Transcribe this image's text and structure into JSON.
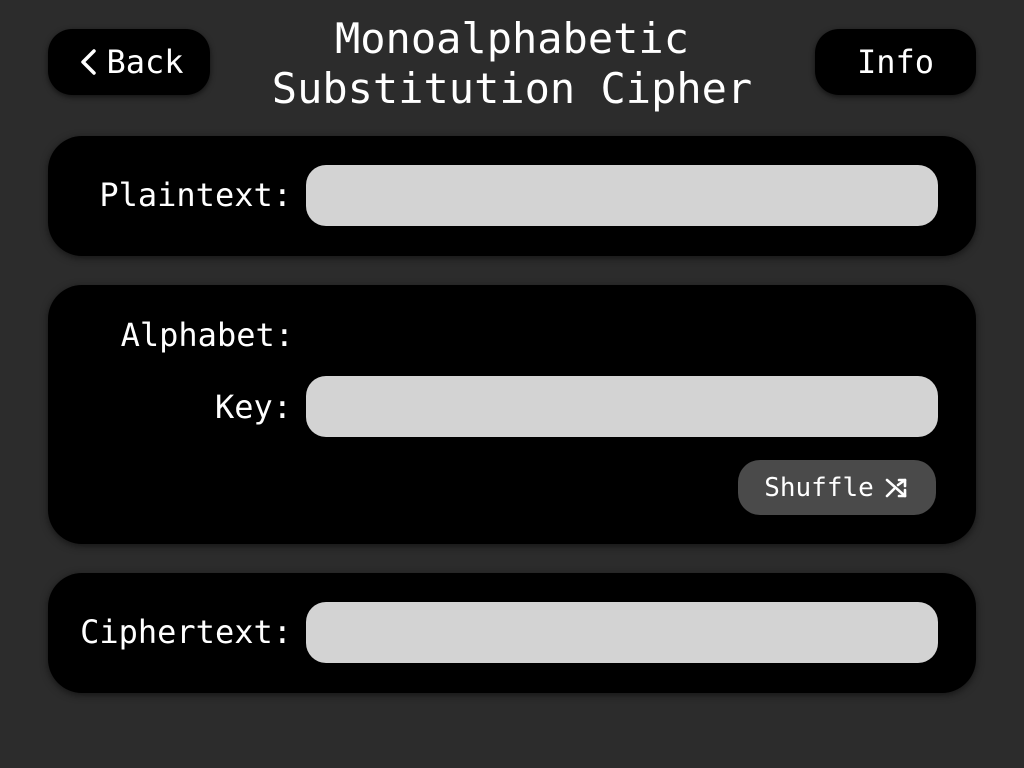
{
  "header": {
    "back_label": "Back",
    "title_line1": "Monoalphabetic",
    "title_line2": "Substitution Cipher",
    "info_label": "Info"
  },
  "plaintext": {
    "label": "Plaintext:",
    "value": "",
    "placeholder": ""
  },
  "key_section": {
    "alphabet_label": "Alphabet:",
    "key_label": "Key:",
    "key_value": "",
    "key_placeholder": "",
    "shuffle_label": "Shuffle"
  },
  "ciphertext": {
    "label": "Ciphertext:",
    "value": "",
    "placeholder": ""
  },
  "icons": {
    "back": "chevron-left-icon",
    "shuffle": "shuffle-icon"
  },
  "colors": {
    "background": "#2c2c2c",
    "panel": "#000000",
    "field": "#d3d3d3",
    "shuffle_button": "#4a4a4a",
    "text": "#ffffff"
  }
}
